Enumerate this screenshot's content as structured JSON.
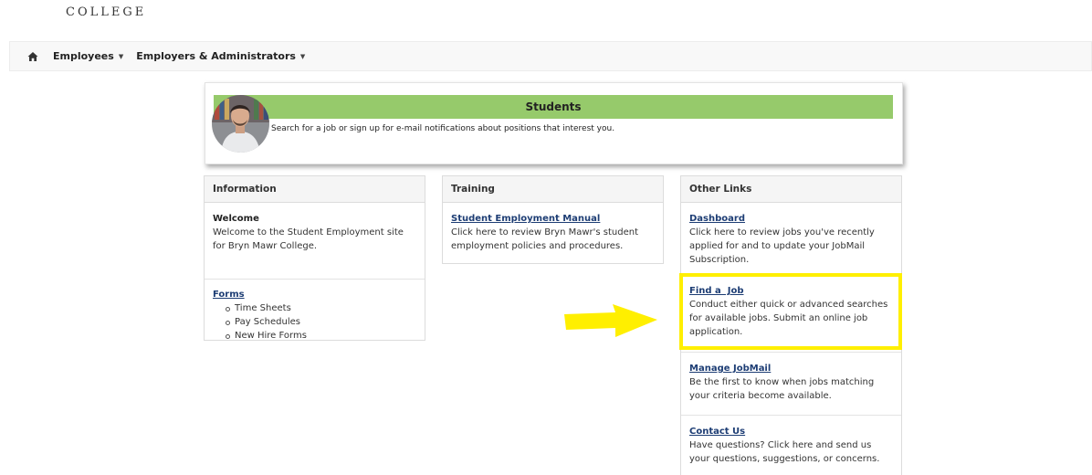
{
  "header": {
    "college_text": "COLLEGE"
  },
  "nav": {
    "items": [
      {
        "label": "Employees"
      },
      {
        "label": "Employers & Administrators"
      }
    ]
  },
  "hero": {
    "title": "Students",
    "description": "Search for a job or sign up for e-mail notifications about positions that interest you."
  },
  "information": {
    "heading": "Information",
    "welcome_title": "Welcome",
    "welcome_text": "Welcome to the Student Employment site for Bryn Mawr College.",
    "forms_link": "Forms",
    "forms_items": [
      "Time Sheets",
      "Pay Schedules",
      "New Hire Forms"
    ]
  },
  "training": {
    "heading": "Training",
    "manual_link": "Student Employment Manual",
    "manual_text": "Click here to review Bryn Mawr's student employment policies and procedures."
  },
  "other_links": {
    "heading": "Other Links",
    "items": [
      {
        "label": "Dashboard",
        "text": "Click here to review jobs you've recently applied for and to update your JobMail Subscription."
      },
      {
        "label": "Find a  Job",
        "text": "Conduct either quick or advanced searches for available jobs. Submit an online job application."
      },
      {
        "label": "Manage JobMail",
        "text": "Be the first to know when jobs matching your criteria become available."
      },
      {
        "label": "Contact Us",
        "text": "Have questions? Click here and send us your questions, suggestions, or concerns."
      }
    ]
  },
  "colors": {
    "hero_bar": "#96ca6b",
    "link": "#1d3d74",
    "highlight": "#ffef00"
  }
}
